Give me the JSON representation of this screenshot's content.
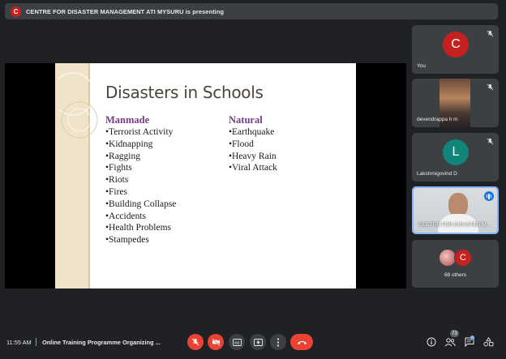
{
  "banner": {
    "avatar_letter": "C",
    "text": "CENTRE FOR DISASTER MANAGEMENT ATI MYSURU is presenting"
  },
  "slide": {
    "title": "Disasters in Schools",
    "left_heading": "Manmade",
    "left_items": [
      "•Terrorist Activity",
      "•Kidnapping",
      "•Ragging",
      "•Fights",
      "•Riots",
      "•Fires",
      "•Building Collapse",
      "•Accidents",
      "•Health Problems",
      "•Stampedes"
    ],
    "right_heading": "Natural",
    "right_items": [
      "•Earthquake",
      "•Flood",
      "•Heavy Rain",
      "•Viral Attack"
    ]
  },
  "participants": {
    "you": {
      "letter": "C",
      "name": "You",
      "color": "#c5221f"
    },
    "p2": {
      "name": "devendrappa h m"
    },
    "p3": {
      "letter": "L",
      "name": "Lakshmigovind D",
      "color": "#12857a"
    },
    "p4": {
      "name": "CENTRE FOR DISASTER M..."
    },
    "others": {
      "letter": "C",
      "label": "68 others"
    }
  },
  "bottom_bar": {
    "time": "11:55 AM",
    "separator": "|",
    "meeting_title": "Online Training Programme Organizing ...",
    "people_count": "73",
    "icons": [
      "mic-off-icon",
      "camera-off-icon",
      "captions-icon",
      "present-icon",
      "more-icon",
      "hangup-icon",
      "info-icon",
      "people-icon",
      "chat-icon",
      "activities-icon"
    ]
  },
  "colors": {
    "background": "#202124",
    "tile": "#3c4043",
    "danger": "#ea4335",
    "accent": "#8ab4f8",
    "heading_purple": "#7a3a8a"
  }
}
